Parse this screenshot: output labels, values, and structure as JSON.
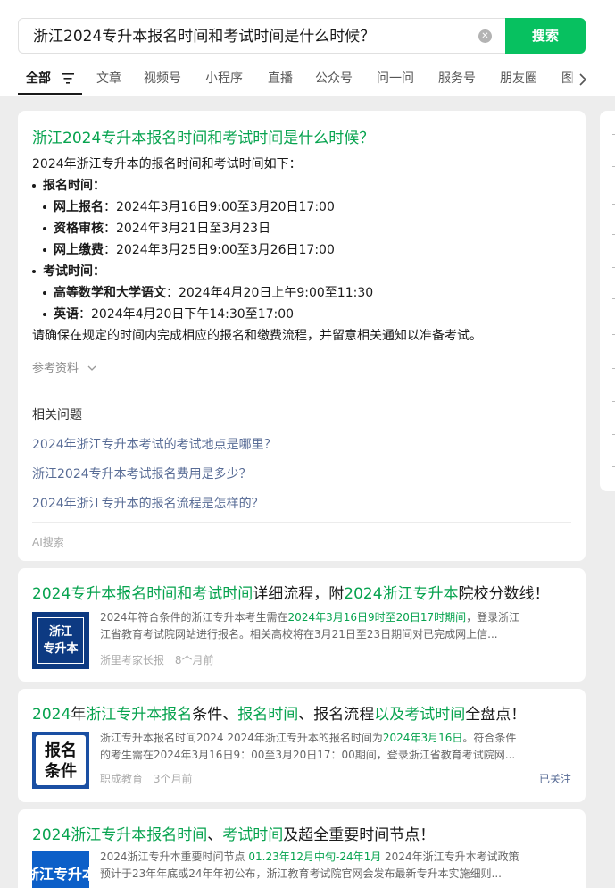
{
  "search": {
    "query": "浙江2024专升本报名时间和考试时间是什么时候？",
    "button_label": "搜索",
    "clear_icon": "clear-icon"
  },
  "tabs": [
    "全部",
    "文章",
    "视频号",
    "小程序",
    "直播",
    "公众号",
    "问一问",
    "服务号",
    "朋友圈",
    "图"
  ],
  "ai_answer": {
    "title": "浙江2024专升本报名时间和考试时间是什么时候？",
    "intro": "2024年浙江专升本的报名时间和考试时间如下：",
    "sections": [
      {
        "heading": "报名时间",
        "items": [
          {
            "label": "网上报名",
            "value": "2024年3月16日9:00至3月20日17:00"
          },
          {
            "label": "资格审核",
            "value": "2024年3月21日至3月23日"
          },
          {
            "label": "网上缴费",
            "value": "2024年3月25日9:00至3月26日17:00"
          }
        ]
      },
      {
        "heading": "考试时间",
        "items": [
          {
            "label": "高等数学和大学语文",
            "value": "2024年4月20日上午9:00至11:30"
          },
          {
            "label": "英语",
            "value": "2024年4月20日下午14:30至17:00"
          }
        ]
      }
    ],
    "colon": "：",
    "outro": "请确保在规定的时间内完成相应的报名和缴费流程，并留意相关通知以准备考试。",
    "reference_label": "参考资料",
    "related_heading": "相关问题",
    "related": [
      "2024年浙江专升本考试的考试地点是哪里？",
      "浙江2024专升本考试报名费用是多少？",
      "2024年浙江专升本的报名流程是怎样的？"
    ],
    "footer": "AI搜索"
  },
  "results": [
    {
      "title_parts": [
        {
          "text": "2024专升本报名时间和考试时间",
          "hl": true
        },
        {
          "text": "详细流程，附",
          "hl": false
        },
        {
          "text": "2024浙江专升本",
          "hl": true
        },
        {
          "text": "院校分数线！",
          "hl": false
        }
      ],
      "thumb_text": [
        "浙江",
        "专升本"
      ],
      "snippet_lines": [
        [
          {
            "text": "2024年符合条件的浙江专升本考生需在",
            "hl": false
          },
          {
            "text": "2024年3月16日9时至20日17时期间",
            "hl": true
          },
          {
            "text": "，登录浙江",
            "hl": false
          }
        ],
        [
          {
            "text": "江省教育考试院网站进行报名。相关高校将在3月21日至23日期间对已完成网上信...",
            "hl": false
          }
        ]
      ],
      "source": "浙里考家长报",
      "time": "8个月前",
      "follow": ""
    },
    {
      "title_parts": [
        {
          "text": "2024",
          "hl": true
        },
        {
          "text": "年",
          "hl": false
        },
        {
          "text": "浙江专升本报名",
          "hl": true
        },
        {
          "text": "条件、",
          "hl": false
        },
        {
          "text": "报名时间",
          "hl": true
        },
        {
          "text": "、报名流程",
          "hl": false
        },
        {
          "text": "以及考试时间",
          "hl": true
        },
        {
          "text": "全盘点！",
          "hl": false
        }
      ],
      "thumb_text": [
        "报名",
        "条件"
      ],
      "snippet_lines": [
        [
          {
            "text": "浙江专升本报名时间2024 2024年浙江专升本的报名时间为",
            "hl": false
          },
          {
            "text": "2024年3月16日",
            "hl": true
          },
          {
            "text": "。符合条件",
            "hl": false
          }
        ],
        [
          {
            "text": "的考生需在2024年3月16日9：00至3月20日17：00期间，登录浙江省教育考试院网...",
            "hl": false
          }
        ]
      ],
      "source": "职成教育",
      "time": "3个月前",
      "follow": "已关注"
    },
    {
      "title_parts": [
        {
          "text": "2024浙江专升本报名时间",
          "hl": true
        },
        {
          "text": "、",
          "hl": false
        },
        {
          "text": "考试时间",
          "hl": true
        },
        {
          "text": "及超全重要时间节点！",
          "hl": false
        }
      ],
      "thumb_text": [
        "浙江专升本"
      ],
      "snippet_lines": [
        [
          {
            "text": "2024浙江专升本重要时间节点 ",
            "hl": false
          },
          {
            "text": "01.23年12月中旬-24年1月",
            "hl": true
          },
          {
            "text": " 2024年浙江专升本考试政策",
            "hl": false
          }
        ],
        [
          {
            "text": "预计于23年年底或24年年初公布，浙江教育考试院官网会发布最新专升本实施细则...",
            "hl": false
          }
        ]
      ],
      "source": "",
      "time": "",
      "follow": ""
    }
  ],
  "colors": {
    "accent": "#07c160",
    "highlight": "#07a34f",
    "link": "#576b95",
    "background": "#ededed"
  }
}
